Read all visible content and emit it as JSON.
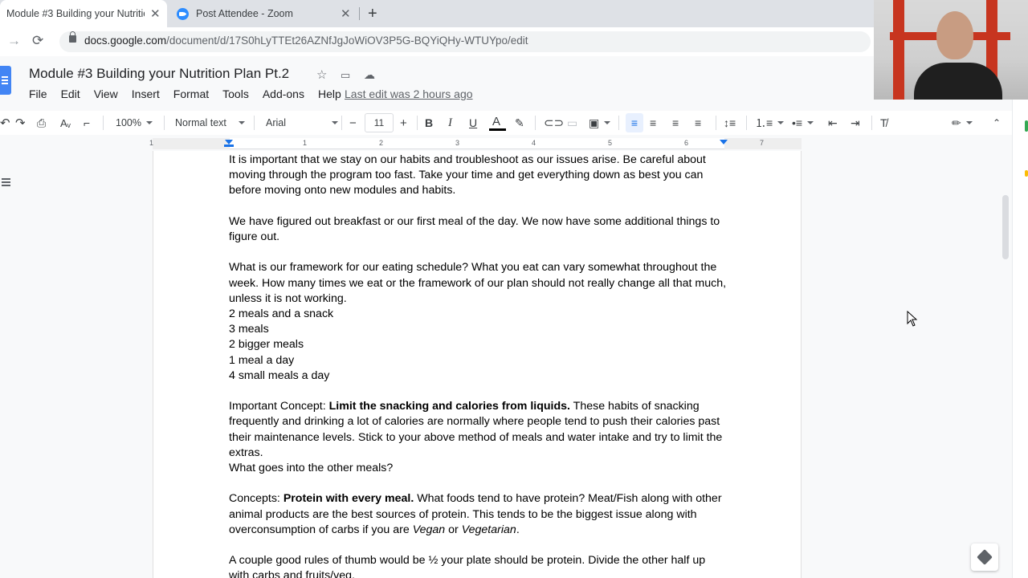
{
  "browser": {
    "tabs": [
      {
        "title": "Module #3 Building your Nutritio",
        "active": true
      },
      {
        "title": "Post Attendee - Zoom",
        "active": false
      }
    ],
    "new_tab_label": "+",
    "close_glyph": "✕",
    "back_glyph": "→",
    "reload_glyph": "⟳",
    "url_host": "docs.google.com",
    "url_path": "/document/d/17S0hLyTTEt26AZNfJgJoWiOV3P5G-BQYiQHy-WTUYpo/edit"
  },
  "docs": {
    "title": "Module #3 Building your Nutrition Plan Pt.2",
    "title_icons": [
      "star-icon",
      "move-folder-icon",
      "cloud-status-icon"
    ],
    "menu": [
      "File",
      "Edit",
      "View",
      "Insert",
      "Format",
      "Tools",
      "Add-ons",
      "Help"
    ],
    "last_edit": "Last edit was 2 hours ago"
  },
  "toolbar": {
    "zoom": "100%",
    "style": "Normal text",
    "font": "Arial",
    "font_size": "11",
    "minus": "−",
    "plus": "+",
    "bold": "B",
    "italic": "I",
    "underline": "U",
    "text_color": "A",
    "text_color_hex": "#000000"
  },
  "ruler": {
    "labels": [
      "1",
      "1",
      "2",
      "3",
      "4",
      "5",
      "6",
      "7"
    ]
  },
  "document": {
    "paragraphs": [
      [
        {
          "t": "It is important that we stay on our habits and troubleshoot as our issues arise.  Be careful about moving through the program too fast.  Take your time and get everything down as best you can before moving onto new modules and habits."
        }
      ],
      [
        {
          "t": "We have figured out breakfast or our first meal of the day.  We now have some additional things to figure out."
        }
      ],
      [
        {
          "t": "What is our framework for our eating schedule? What you eat can vary somewhat throughout the week.  How many times we eat or the framework of our plan should not really change all that much, unless it is not working."
        }
      ],
      [
        {
          "t": "2 meals and a snack"
        }
      ],
      [
        {
          "t": "3 meals"
        }
      ],
      [
        {
          "t": "2 bigger meals"
        }
      ],
      [
        {
          "t": "1 meal a day"
        }
      ],
      [
        {
          "t": "4 small meals a day"
        }
      ],
      [
        {
          "t": "Important Concept: "
        },
        {
          "t": "Limit the snacking and calories from liquids.",
          "b": true
        },
        {
          "t": "  These habits of snacking frequently and drinking a lot of calories are normally where people tend to push their calories past their maintenance levels.  Stick to your above method of meals and water intake and try to limit the extras."
        }
      ],
      [
        {
          "t": "What goes into the other meals?"
        }
      ],
      [
        {
          "t": "Concepts: "
        },
        {
          "t": "Protein with every meal.",
          "b": true
        },
        {
          "t": " What foods tend to have protein? Meat/Fish along with other animal products are the best sources of protein.  This tends to be the biggest issue along with overconsumption of carbs if you are "
        },
        {
          "t": "Vegan",
          "i": true
        },
        {
          "t": " or "
        },
        {
          "t": "Vegetarian",
          "i": true
        },
        {
          "t": "."
        }
      ],
      [
        {
          "t": "A couple good rules of thumb would be ½ your plate should be protein.  Divide the other half up with carbs and fruits/veg."
        }
      ]
    ],
    "gaps_after": [
      0,
      1,
      7,
      9,
      10
    ]
  },
  "colors": {
    "accent": "#1a73e8",
    "docs_blue": "#4285f4",
    "zoom_blue": "#2d8cff"
  }
}
